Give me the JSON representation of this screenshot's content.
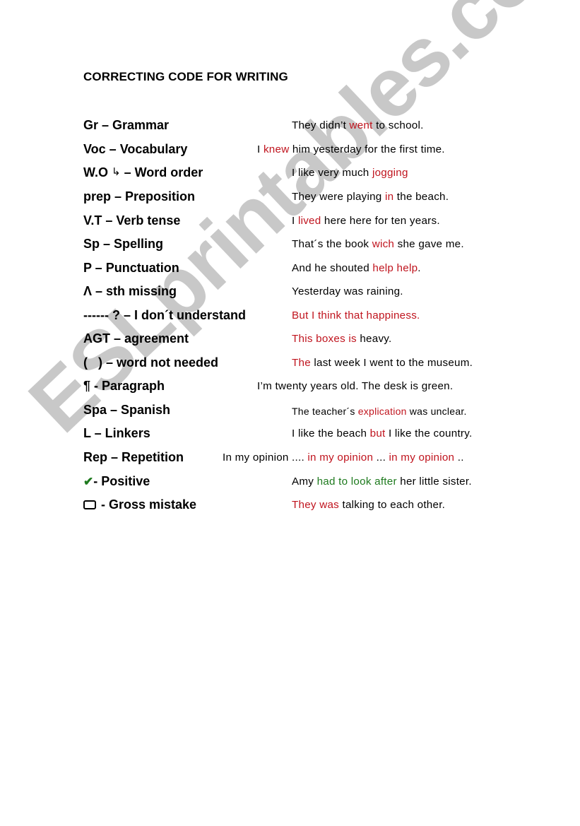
{
  "document": {
    "title": "CORRECTING CODE FOR WRITING",
    "watermark": "ESLprintables.com",
    "colors": {
      "error_highlight": "#c0141e",
      "positive_highlight": "#1e7a1e",
      "watermark": "#c8c8c8",
      "text": "#000000"
    }
  },
  "codes": [
    {
      "code": "Gr – Grammar",
      "icon": null,
      "example": [
        {
          "text": "They didn’t ",
          "style": "normal"
        },
        {
          "text": "went",
          "style": "red"
        },
        {
          "text": " to school.",
          "style": "normal"
        }
      ]
    },
    {
      "code": "Voc – Vocabulary",
      "icon": null,
      "example": [
        {
          "text": "I ",
          "style": "normal"
        },
        {
          "text": "knew",
          "style": "red"
        },
        {
          "text": " him yesterday for the first time.",
          "style": "normal"
        }
      ]
    },
    {
      "code_prefix": "W.O ",
      "icon": "word-order-arrow-icon",
      "icon_glyph": "↳",
      "code": " – Word order",
      "example": [
        {
          "text": "I like very much ",
          "style": "normal"
        },
        {
          "text": "jogging",
          "style": "red"
        }
      ]
    },
    {
      "code": "prep – Preposition",
      "icon": null,
      "example": [
        {
          "text": "They were playing ",
          "style": "normal"
        },
        {
          "text": "in",
          "style": "red"
        },
        {
          "text": " the beach.",
          "style": "normal"
        }
      ]
    },
    {
      "code": "V.T – Verb tense",
      "icon": null,
      "example": [
        {
          "text": "I ",
          "style": "normal"
        },
        {
          "text": "lived",
          "style": "red"
        },
        {
          "text": " here here for ten years.",
          "style": "normal"
        }
      ]
    },
    {
      "code": "Sp – Spelling",
      "icon": null,
      "example": [
        {
          "text": "That´s the book ",
          "style": "normal"
        },
        {
          "text": "wich",
          "style": "red"
        },
        {
          "text": " she gave me.",
          "style": "normal"
        }
      ]
    },
    {
      "code": "P – Punctuation",
      "icon": null,
      "example": [
        {
          "text": "And he shouted ",
          "style": "normal"
        },
        {
          "text": "help help",
          "style": "red"
        },
        {
          "text": ".",
          "style": "normal"
        }
      ]
    },
    {
      "code": "Λ – sth missing",
      "icon": null,
      "example": [
        {
          "text": "Yesterday was raining.",
          "style": "normal"
        }
      ]
    },
    {
      "code": "------ ? – I don´t understand",
      "icon": null,
      "example": [
        {
          "text": "But I think that happiness.",
          "style": "red"
        }
      ]
    },
    {
      "code": "AGT – agreement",
      "icon": null,
      "example": [
        {
          "text": "This boxes is",
          "style": "red"
        },
        {
          "text": " heavy.",
          "style": "normal"
        }
      ]
    },
    {
      "code": "(   ) – word not needed",
      "icon": null,
      "example": [
        {
          "text": "The",
          "style": "red"
        },
        {
          "text": " last week I went to the museum.",
          "style": "normal"
        }
      ]
    },
    {
      "code": "¶ - Paragraph",
      "icon": null,
      "example": [
        {
          "text": "I’m twenty years old. The desk is green.",
          "style": "normal"
        }
      ]
    },
    {
      "code": "Spa – Spanish",
      "icon": null,
      "example": [
        {
          "text": "The teacher´s ",
          "style": "normal"
        },
        {
          "text": "explication",
          "style": "red"
        },
        {
          "text": " was unclear.",
          "style": "normal"
        }
      ]
    },
    {
      "code": "L – Linkers",
      "icon": null,
      "example": [
        {
          "text": "I like the beach ",
          "style": "normal"
        },
        {
          "text": "but",
          "style": "red"
        },
        {
          "text": " I like the country.",
          "style": "normal"
        }
      ]
    },
    {
      "code": "Rep – Repetition",
      "icon": null,
      "example": [
        {
          "text": "In my opinion .... ",
          "style": "normal"
        },
        {
          "text": "in my opinion",
          "style": "red"
        },
        {
          "text": " ... ",
          "style": "normal"
        },
        {
          "text": "in my opinion",
          "style": "red"
        },
        {
          "text": " ..",
          "style": "normal"
        }
      ]
    },
    {
      "code_prefix": "",
      "icon": "check-icon",
      "icon_glyph": "✔",
      "code": "- Positive",
      "example": [
        {
          "text": "Amy ",
          "style": "normal"
        },
        {
          "text": "had to look after",
          "style": "green"
        },
        {
          "text": " her little sister.",
          "style": "normal"
        }
      ]
    },
    {
      "code_prefix": "",
      "icon": "box-icon",
      "icon_glyph": "",
      "code": " - Gross mistake",
      "example": [
        {
          "text": "They was",
          "style": "red"
        },
        {
          "text": " talking to each other.",
          "style": "normal"
        }
      ]
    }
  ]
}
